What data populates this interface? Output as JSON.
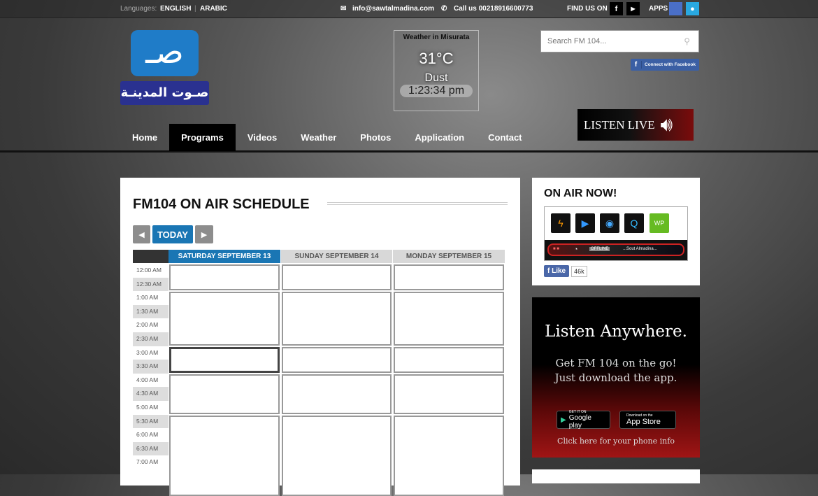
{
  "topbar": {
    "languages_label": "Languages:",
    "lang_english": "ENGLISH",
    "lang_arabic": "ARABIC",
    "email": "info@sawtalmadina.com",
    "phone": "Call us 00218916600773",
    "find_us": "FIND US ON",
    "apps": "APPS"
  },
  "logo": {
    "mark": "صـ",
    "name": "صـوت المدينـة"
  },
  "weather": {
    "title": "Weather in Misurata",
    "temp": "31°C",
    "condition": "Dust",
    "time": "1:23:34 pm"
  },
  "search": {
    "placeholder": "Search FM 104..."
  },
  "facebook_connect": "Connect with Facebook",
  "listen_live": "LISTEN LIVE",
  "nav": [
    "Home",
    "Programs",
    "Videos",
    "Weather",
    "Photos",
    "Application",
    "Contact"
  ],
  "nav_active": "Programs",
  "schedule": {
    "title": "FM104 ON AIR SCHEDULE",
    "prev": "◀",
    "today": "TODAY",
    "next": "▶",
    "days": [
      {
        "label": "SATURDAY SEPTEMBER 13",
        "selected": true
      },
      {
        "label": "SUNDAY SEPTEMBER 14",
        "selected": false
      },
      {
        "label": "MONDAY SEPTEMBER 15",
        "selected": false
      }
    ],
    "times": [
      "12:00 AM",
      "12:30 AM",
      "1:00 AM",
      "1:30 AM",
      "2:00 AM",
      "2:30 AM",
      "3:00 AM",
      "3:30 AM",
      "4:00 AM",
      "4:30 AM",
      "5:00 AM",
      "5:30 AM",
      "6:00 AM",
      "6:30 AM",
      "7:00 AM"
    ],
    "blocks": [
      {
        "start": "12:00 AM",
        "end": "1:00 AM"
      },
      {
        "start": "1:00 AM",
        "end": "3:00 AM"
      },
      {
        "start": "3:00 AM",
        "end": "4:00 AM"
      },
      {
        "start": "4:00 AM",
        "end": "5:30 AM"
      },
      {
        "start": "5:30 AM",
        "end": "8:30 AM"
      }
    ],
    "current": {
      "day": 0,
      "block": 2
    }
  },
  "on_air": {
    "title": "ON AIR NOW!",
    "player_icons": [
      "winamp-icon",
      "windows-media-icon",
      "realplayer-icon",
      "quicktime-icon",
      "wp-icon"
    ],
    "status": "OFFLINE",
    "station": "...Sout Almadina...",
    "like": "Like",
    "like_count": "46k"
  },
  "ad": {
    "headline": "Listen Anywhere.",
    "line1": "Get FM 104 on the go!",
    "line2": "Just download the app.",
    "google_small": "GET IT ON",
    "google": "Google play",
    "apple_small": "Download on the",
    "apple": "App Store",
    "info": "Click here for your phone info"
  }
}
